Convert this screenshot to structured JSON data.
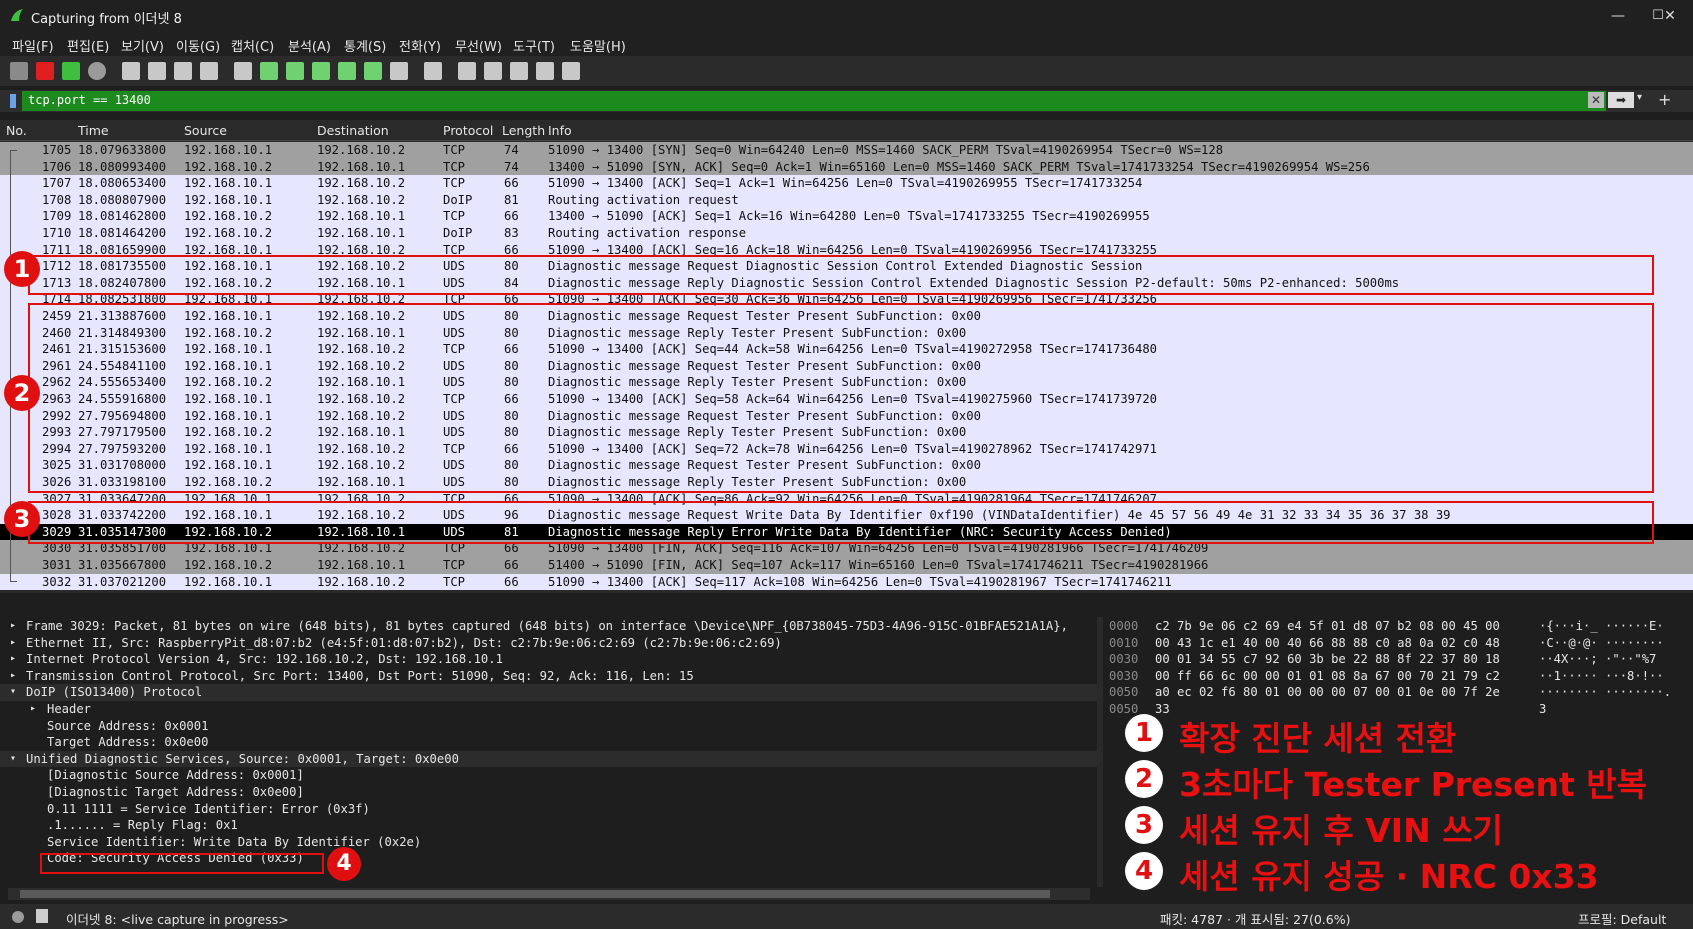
{
  "window": {
    "title": "Capturing from 이더넷 8",
    "minimize": "—",
    "maximize": "☐",
    "close": "✕"
  },
  "menu": [
    "파일(F)",
    "편집(E)",
    "보기(V)",
    "이동(G)",
    "캡처(C)",
    "분석(A)",
    "통계(S)",
    "전화(Y)",
    "무선(W)",
    "도구(T)",
    "도움말(H)"
  ],
  "toolbar_icons": [
    "shark-fin-icon",
    "stop-icon",
    "restart-icon",
    "options-icon",
    "open-icon",
    "save-icon",
    "close-file-icon",
    "reload-icon",
    "find-icon",
    "back-icon",
    "forward-icon",
    "goto-icon",
    "first-icon",
    "last-icon",
    "autoscroll-icon",
    "colorize-icon",
    "zoom-in-icon",
    "zoom-out-icon",
    "zoom-reset-icon",
    "resize-columns-icon",
    "layout-icon"
  ],
  "filter": {
    "value": "tcp.port == 13400"
  },
  "columns": {
    "no": "No.",
    "time": "Time",
    "source": "Source",
    "destination": "Destination",
    "protocol": "Protocol",
    "length": "Length",
    "info": "Info"
  },
  "packets": [
    {
      "no": "1705",
      "time": "18.079633800",
      "src": "192.168.10.1",
      "dst": "192.168.10.2",
      "proto": "TCP",
      "len": "74",
      "info": "51090 → 13400 [SYN] Seq=0 Win=64240 Len=0 MSS=1460 SACK_PERM TSval=4190269954 TSecr=0 WS=128",
      "style": "fin"
    },
    {
      "no": "1706",
      "time": "18.080993400",
      "src": "192.168.10.2",
      "dst": "192.168.10.1",
      "proto": "TCP",
      "len": "74",
      "info": "13400 → 51090 [SYN, ACK] Seq=0 Ack=1 Win=65160 Len=0 MSS=1460 SACK_PERM TSval=1741733254 TSecr=4190269954 WS=256",
      "style": "fin"
    },
    {
      "no": "1707",
      "time": "18.080653400",
      "src": "192.168.10.1",
      "dst": "192.168.10.2",
      "proto": "TCP",
      "len": "66",
      "info": "51090 → 13400 [ACK] Seq=1 Ack=1 Win=64256 Len=0 TSval=4190269955 TSecr=1741733254",
      "style": "tcp"
    },
    {
      "no": "1708",
      "time": "18.080807900",
      "src": "192.168.10.1",
      "dst": "192.168.10.2",
      "proto": "DoIP",
      "len": "81",
      "info": "Routing activation request",
      "style": "tcp"
    },
    {
      "no": "1709",
      "time": "18.081462800",
      "src": "192.168.10.2",
      "dst": "192.168.10.1",
      "proto": "TCP",
      "len": "66",
      "info": "13400 → 51090 [ACK] Seq=1 Ack=16 Win=64280 Len=0 TSval=1741733255 TSecr=4190269955",
      "style": "tcp"
    },
    {
      "no": "1710",
      "time": "18.081464200",
      "src": "192.168.10.2",
      "dst": "192.168.10.1",
      "proto": "DoIP",
      "len": "83",
      "info": "Routing activation response",
      "style": "tcp"
    },
    {
      "no": "1711",
      "time": "18.081659900",
      "src": "192.168.10.1",
      "dst": "192.168.10.2",
      "proto": "TCP",
      "len": "66",
      "info": "51090 → 13400 [ACK] Seq=16 Ack=18 Win=64256 Len=0 TSval=4190269956 TSecr=1741733255",
      "style": "tcp"
    },
    {
      "no": "1712",
      "time": "18.081735500",
      "src": "192.168.10.1",
      "dst": "192.168.10.2",
      "proto": "UDS",
      "len": "80",
      "info": "Diagnostic message Request   Diagnostic Session Control              Extended Diagnostic Session",
      "style": "tcp"
    },
    {
      "no": "1713",
      "time": "18.082407800",
      "src": "192.168.10.2",
      "dst": "192.168.10.1",
      "proto": "UDS",
      "len": "84",
      "info": "Diagnostic message Reply     Diagnostic Session Control              Extended Diagnostic Session   P2-default:   50ms  P2-enhanced:  5000ms",
      "style": "tcp"
    },
    {
      "no": "1714",
      "time": "18.082531800",
      "src": "192.168.10.1",
      "dst": "192.168.10.2",
      "proto": "TCP",
      "len": "66",
      "info": "51090 → 13400 [ACK] Seq=30 Ack=36 Win=64256 Len=0 TSval=4190269956 TSecr=1741733256",
      "style": "tcp"
    },
    {
      "no": "2459",
      "time": "21.313887600",
      "src": "192.168.10.1",
      "dst": "192.168.10.2",
      "proto": "UDS",
      "len": "80",
      "info": "Diagnostic message Request   Tester Present                          SubFunction: 0x00",
      "style": "tcp"
    },
    {
      "no": "2460",
      "time": "21.314849300",
      "src": "192.168.10.2",
      "dst": "192.168.10.1",
      "proto": "UDS",
      "len": "80",
      "info": "Diagnostic message Reply     Tester Present                          SubFunction: 0x00",
      "style": "tcp"
    },
    {
      "no": "2461",
      "time": "21.315153600",
      "src": "192.168.10.1",
      "dst": "192.168.10.2",
      "proto": "TCP",
      "len": "66",
      "info": "51090 → 13400 [ACK] Seq=44 Ack=58 Win=64256 Len=0 TSval=4190272958 TSecr=1741736480",
      "style": "tcp"
    },
    {
      "no": "2961",
      "time": "24.554841100",
      "src": "192.168.10.1",
      "dst": "192.168.10.2",
      "proto": "UDS",
      "len": "80",
      "info": "Diagnostic message Request   Tester Present                          SubFunction: 0x00",
      "style": "tcp"
    },
    {
      "no": "2962",
      "time": "24.555653400",
      "src": "192.168.10.2",
      "dst": "192.168.10.1",
      "proto": "UDS",
      "len": "80",
      "info": "Diagnostic message Reply     Tester Present                          SubFunction: 0x00",
      "style": "tcp"
    },
    {
      "no": "2963",
      "time": "24.555916800",
      "src": "192.168.10.1",
      "dst": "192.168.10.2",
      "proto": "TCP",
      "len": "66",
      "info": "51090 → 13400 [ACK] Seq=58 Ack=64 Win=64256 Len=0 TSval=4190275960 TSecr=1741739720",
      "style": "tcp"
    },
    {
      "no": "2992",
      "time": "27.795694800",
      "src": "192.168.10.1",
      "dst": "192.168.10.2",
      "proto": "UDS",
      "len": "80",
      "info": "Diagnostic message Request   Tester Present                          SubFunction: 0x00",
      "style": "tcp"
    },
    {
      "no": "2993",
      "time": "27.797179500",
      "src": "192.168.10.2",
      "dst": "192.168.10.1",
      "proto": "UDS",
      "len": "80",
      "info": "Diagnostic message Reply     Tester Present                          SubFunction: 0x00",
      "style": "tcp"
    },
    {
      "no": "2994",
      "time": "27.797593200",
      "src": "192.168.10.1",
      "dst": "192.168.10.2",
      "proto": "TCP",
      "len": "66",
      "info": "51090 → 13400 [ACK] Seq=72 Ack=78 Win=64256 Len=0 TSval=4190278962 TSecr=1741742971",
      "style": "tcp"
    },
    {
      "no": "3025",
      "time": "31.031708000",
      "src": "192.168.10.1",
      "dst": "192.168.10.2",
      "proto": "UDS",
      "len": "80",
      "info": "Diagnostic message Request   Tester Present                          SubFunction: 0x00",
      "style": "tcp"
    },
    {
      "no": "3026",
      "time": "31.033198100",
      "src": "192.168.10.2",
      "dst": "192.168.10.1",
      "proto": "UDS",
      "len": "80",
      "info": "Diagnostic message Reply     Tester Present                          SubFunction: 0x00",
      "style": "tcp"
    },
    {
      "no": "3027",
      "time": "31.033647200",
      "src": "192.168.10.1",
      "dst": "192.168.10.2",
      "proto": "TCP",
      "len": "66",
      "info": "51090 → 13400 [ACK] Seq=86 Ack=92 Win=64256 Len=0 TSval=4190281964 TSecr=1741746207",
      "style": "tcp"
    },
    {
      "no": "3028",
      "time": "31.033742200",
      "src": "192.168.10.1",
      "dst": "192.168.10.2",
      "proto": "UDS",
      "len": "96",
      "info": "Diagnostic message Request   Write Data By Identifier                0xf190 (VINDataIdentifier)    4e 45 57 56 49 4e 31 32 33 34 35 36 37 38 39",
      "style": "tcp"
    },
    {
      "no": "3029",
      "time": "31.035147300",
      "src": "192.168.10.2",
      "dst": "192.168.10.1",
      "proto": "UDS",
      "len": "81",
      "info": "Diagnostic message Reply     Error                                   Write Data By Identifier (NRC: Security Access Denied)",
      "style": "sel"
    },
    {
      "no": "3030",
      "time": "31.035851700",
      "src": "192.168.10.1",
      "dst": "192.168.10.2",
      "proto": "TCP",
      "len": "66",
      "info": "51090 → 13400 [FIN, ACK] Seq=116 Ack=107 Win=64256 Len=0 TSval=4190281966 TSecr=1741746209",
      "style": "fin"
    },
    {
      "no": "3031",
      "time": "31.035667800",
      "src": "192.168.10.2",
      "dst": "192.168.10.1",
      "proto": "TCP",
      "len": "66",
      "info": "51400 → 51090 [FIN, ACK] Seq=107 Ack=117 Win=65160 Len=0 TSval=1741746211 TSecr=4190281966",
      "style": "fin"
    },
    {
      "no": "3032",
      "time": "31.037021200",
      "src": "192.168.10.1",
      "dst": "192.168.10.2",
      "proto": "TCP",
      "len": "66",
      "info": "51090 → 13400 [ACK] Seq=117 Ack=108 Win=64256 Len=0 TSval=4190281967 TSecr=1741746211",
      "style": "tcp"
    }
  ],
  "details": [
    {
      "text": "Frame 3029: Packet, 81 bytes on wire (648 bits), 81 bytes captured (648 bits) on interface \\Device\\NPF_{0B738045-75D3-4A96-915C-01BFAE521A1A},",
      "indent": 0,
      "arrow": "▸"
    },
    {
      "text": "Ethernet II, Src: RaspberryPit_d8:07:b2 (e4:5f:01:d8:07:b2), Dst: c2:7b:9e:06:c2:69 (c2:7b:9e:06:c2:69)",
      "indent": 0,
      "arrow": "▸"
    },
    {
      "text": "Internet Protocol Version 4, Src: 192.168.10.2, Dst: 192.168.10.1",
      "indent": 0,
      "arrow": "▸"
    },
    {
      "text": "Transmission Control Protocol, Src Port: 13400, Dst Port: 51090, Seq: 92, Ack: 116, Len: 15",
      "indent": 0,
      "arrow": "▸"
    },
    {
      "text": "DoIP (ISO13400) Protocol",
      "indent": 0,
      "arrow": "▾"
    },
    {
      "text": "Header",
      "indent": 1,
      "arrow": "▸"
    },
    {
      "text": "Source Address: 0x0001",
      "indent": 1,
      "arrow": ""
    },
    {
      "text": "Target Address: 0x0e00",
      "indent": 1,
      "arrow": ""
    },
    {
      "text": "Unified Diagnostic Services, Source: 0x0001, Target: 0x0e00",
      "indent": 0,
      "arrow": "▾"
    },
    {
      "text": "[Diagnostic Source Address: 0x0001]",
      "indent": 1,
      "arrow": ""
    },
    {
      "text": "[Diagnostic Target Address: 0x0e00]",
      "indent": 1,
      "arrow": ""
    },
    {
      "text": "0.11 1111 = Service Identifier: Error (0x3f)",
      "indent": 1,
      "arrow": ""
    },
    {
      "text": ".1...... = Reply Flag: 0x1",
      "indent": 1,
      "arrow": ""
    },
    {
      "text": "Service Identifier: Write Data By Identifier (0x2e)",
      "indent": 1,
      "arrow": ""
    },
    {
      "text": "Code: Security Access Denied (0x33)",
      "indent": 1,
      "arrow": ""
    }
  ],
  "hex": [
    {
      "off": "0000",
      "bytes": "c2 7b 9e 06 c2 69 e4 5f  01 d8 07 b2 08 00 45 00",
      "ascii": "·{···i·_ ······E·"
    },
    {
      "off": "0010",
      "bytes": "00 43 1c e1 40 00 40 66  88 88 c0 a8 0a 02 c0 48",
      "ascii": "·C··@·@· ········"
    },
    {
      "off": "0030",
      "bytes": "00 01 34 55 c7 92 60 3b  be 22 88 8f 22 37 80 18",
      "ascii": "··4X···; ·\"··\"%7"
    },
    {
      "off": "0030",
      "bytes": "00 ff 66 6c 00 00 01 01  08 8a 67 00 70 21 79 c2",
      "ascii": "··1····· ···8·!··"
    },
    {
      "off": "0050",
      "bytes": "a0 ec 02 f6 80 01 00 00  00 07 00 01 0e 00 7f 2e",
      "ascii": "········ ········."
    },
    {
      "off": "0050",
      "bytes": "33",
      "ascii": "3"
    }
  ],
  "annotations": [
    {
      "num": "1",
      "text": "확장 진단 세션 전환"
    },
    {
      "num": "2",
      "text": "3초마다 Tester Present 반복"
    },
    {
      "num": "3",
      "text": "세션 유지 후 VIN 쓰기"
    },
    {
      "num": "4",
      "text": "세션 유지 성공 · NRC 0x33"
    }
  ],
  "status": {
    "interface": "이더넷 8: <live capture in progress>",
    "packets": "패킷: 4787 · 개 표시됨: 27(0.6%)",
    "profile": "프로필: Default"
  },
  "colors": {
    "accent_red": "#e01010",
    "filter_green": "#1c8a1c",
    "tcp_row": "#e7e6ff",
    "fin_row": "#a0a0a0"
  }
}
